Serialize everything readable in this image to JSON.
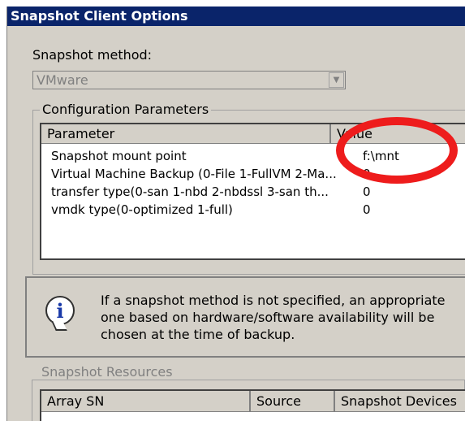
{
  "dialog": {
    "title": "Snapshot Client Options",
    "snapshot_method_label": "Snapshot  method:",
    "snapshot_method_value": "VMware",
    "config_group_title": "Configuration Parameters",
    "params_table": {
      "columns": [
        "Parameter",
        "Value"
      ],
      "rows": [
        [
          "Snapshot mount point",
          "f:\\mnt"
        ],
        [
          "Virtual Machine Backup (0-File 1-FullVM 2-Ma...",
          "0"
        ],
        [
          "transfer type(0-san 1-nbd 2-nbdssl 3-san th...",
          "0"
        ],
        [
          "vmdk type(0-optimized 1-full)",
          "0"
        ]
      ]
    },
    "info_icon": "information-icon",
    "info_text": "If a snapshot method is not specified, an appropriate one based on hardware/software availability will be chosen at the time of backup.",
    "resources_group_title": "Snapshot Resources",
    "resources_table": {
      "columns": [
        "Array SN",
        "Source",
        "Snapshot Devices"
      ]
    }
  },
  "annotation": {
    "shape": "circle",
    "color": "#ee1c1c",
    "target": "Value column"
  }
}
